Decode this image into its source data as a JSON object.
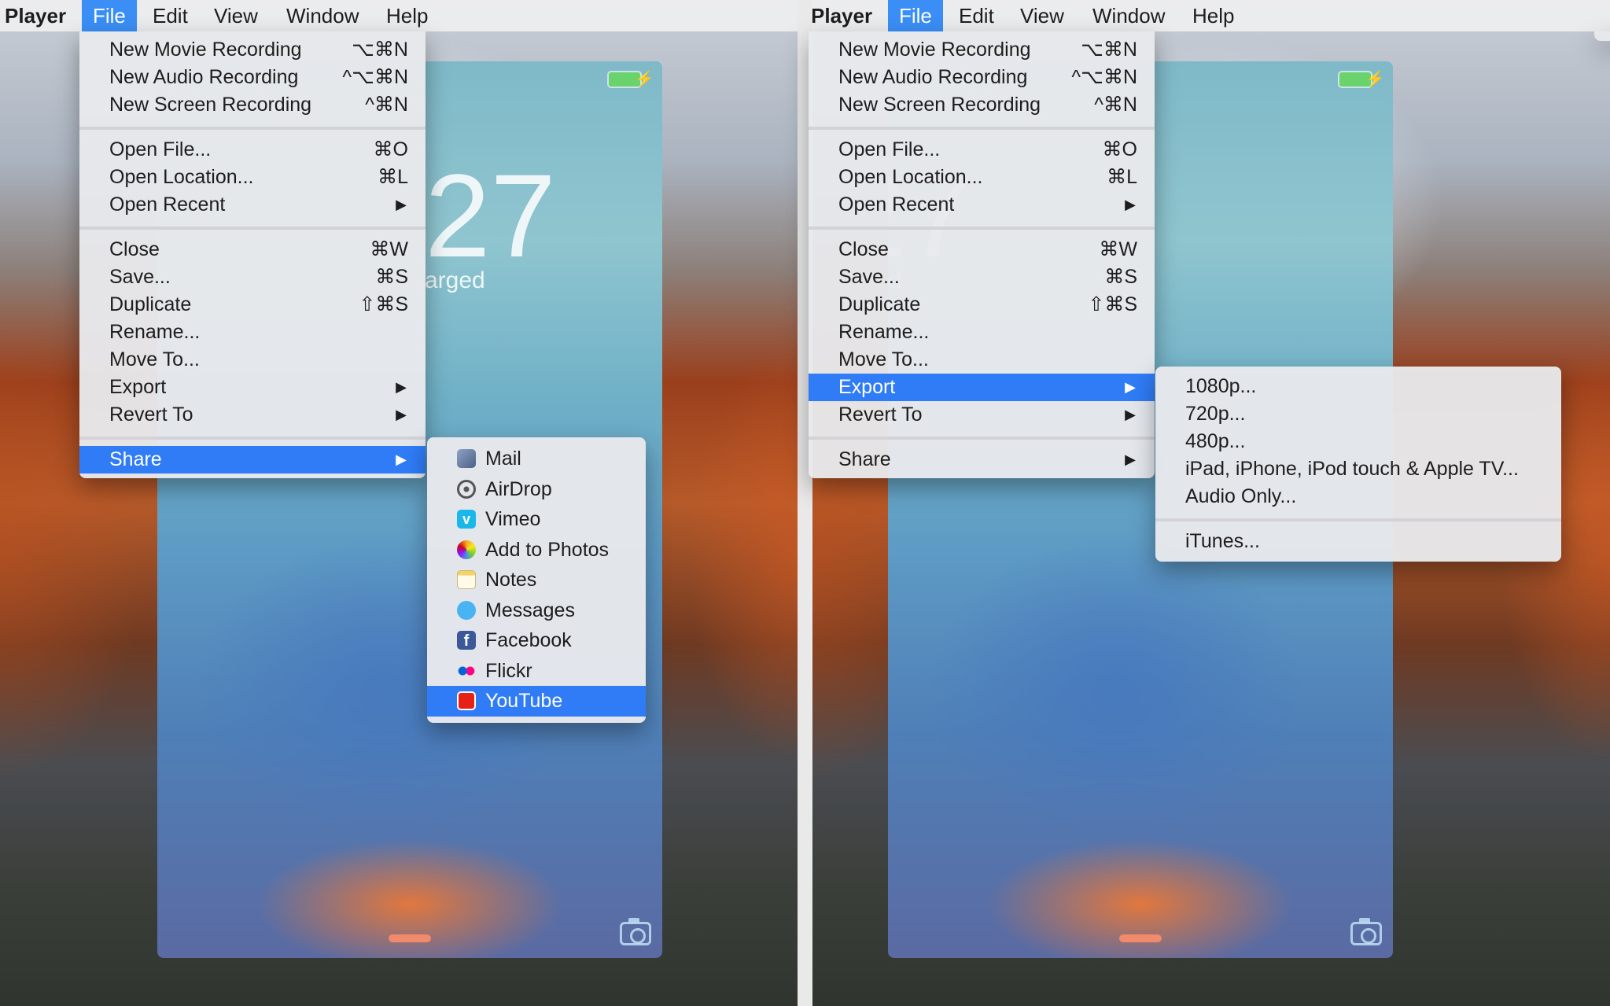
{
  "menubar": {
    "app_name": "Player",
    "menus": [
      "File",
      "Edit",
      "View",
      "Window",
      "Help"
    ]
  },
  "phone": {
    "time_fragment": "27",
    "status_fragment": "arged"
  },
  "file_menu": {
    "group1": [
      {
        "label": "New Movie Recording",
        "shortcut": "⌥⌘N"
      },
      {
        "label": "New Audio Recording",
        "shortcut": "^⌥⌘N"
      },
      {
        "label": "New Screen Recording",
        "shortcut": "^⌘N"
      }
    ],
    "group2": [
      {
        "label": "Open File...",
        "shortcut": "⌘O"
      },
      {
        "label": "Open Location...",
        "shortcut": "⌘L"
      },
      {
        "label": "Open Recent",
        "submenu": true
      }
    ],
    "group3": [
      {
        "label": "Close",
        "shortcut": "⌘W"
      },
      {
        "label": "Save...",
        "shortcut": "⌘S"
      },
      {
        "label": "Duplicate",
        "shortcut": "⇧⌘S"
      },
      {
        "label": "Rename..."
      },
      {
        "label": "Move To..."
      },
      {
        "label": "Export",
        "submenu": true
      },
      {
        "label": "Revert To",
        "submenu": true
      }
    ],
    "group4": [
      {
        "label": "Share",
        "submenu": true
      }
    ],
    "arrow_glyph": "▶"
  },
  "share_menu": {
    "items": [
      {
        "label": "Mail",
        "icon": "mail-icon"
      },
      {
        "label": "AirDrop",
        "icon": "airdrop-icon"
      },
      {
        "label": "Vimeo",
        "icon": "vimeo-icon"
      },
      {
        "label": "Add to Photos",
        "icon": "photos-icon"
      },
      {
        "label": "Notes",
        "icon": "notes-icon"
      },
      {
        "label": "Messages",
        "icon": "messages-icon"
      },
      {
        "label": "Facebook",
        "icon": "facebook-icon"
      },
      {
        "label": "Flickr",
        "icon": "flickr-icon"
      },
      {
        "label": "YouTube",
        "icon": "youtube-icon"
      }
    ]
  },
  "export_menu": {
    "items": [
      "1080p...",
      "720p...",
      "480p...",
      "iPad, iPhone, iPod touch & Apple TV...",
      "Audio Only..."
    ],
    "extra": "iTunes..."
  },
  "colors": {
    "selection": "#2f7cf6",
    "menubar_active": "#3a8ef5"
  }
}
